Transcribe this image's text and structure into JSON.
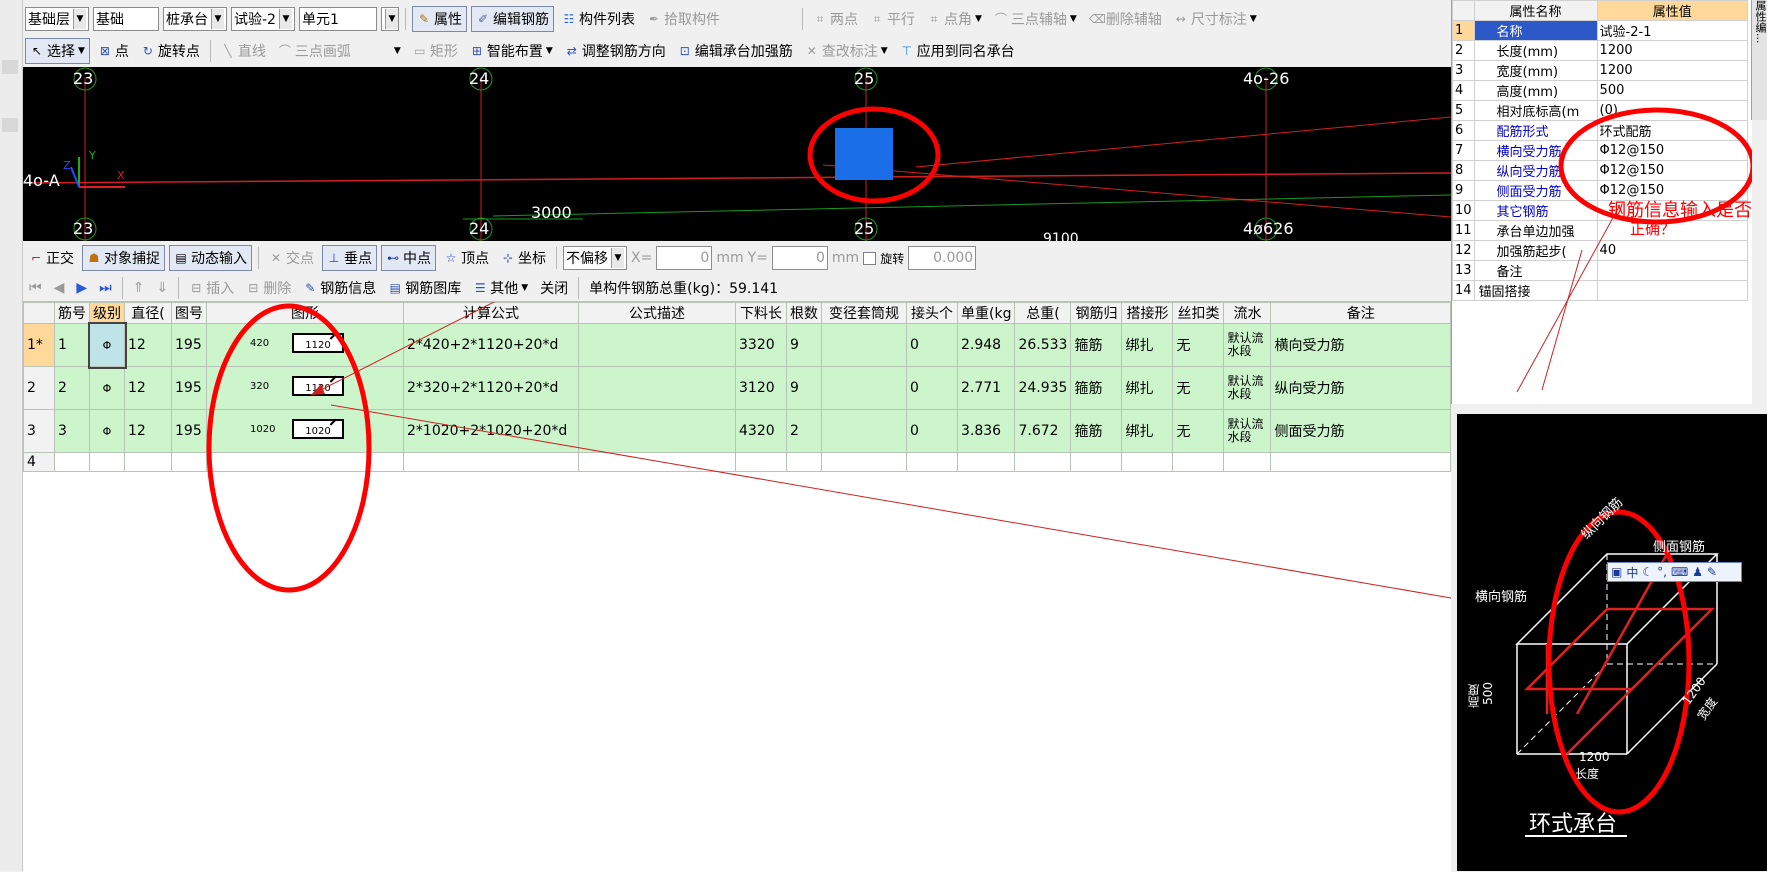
{
  "toolbar1": {
    "sel_category": "基础层",
    "sel_sub": "基础",
    "sel_type": "桩承台",
    "sel_name": "试验-2",
    "sel_unit": "单元1",
    "btn_attr": "属性",
    "btn_edit_rebar": "编辑钢筋",
    "btn_comp_list": "构件列表",
    "btn_pick": "拾取构件",
    "btn_two_pt": "两点",
    "btn_parallel": "平行",
    "btn_pt_angle": "点角",
    "btn_three_axis": "三点辅轴",
    "btn_del_axis": "删除辅轴",
    "btn_dim": "尺寸标注"
  },
  "toolbar2": {
    "btn_select": "选择",
    "btn_point": "点",
    "btn_rot_point": "旋转点",
    "btn_line": "直线",
    "btn_arc": "三点画弧",
    "btn_rect": "矩形",
    "btn_smart": "智能布置",
    "btn_adjust_dir": "调整钢筋方向",
    "btn_edit_reinf": "编辑承台加强筋",
    "btn_check_label": "查改标注",
    "btn_apply_same": "应用到同名承台"
  },
  "canvas": {
    "axis_labels_top": [
      "23",
      "24",
      "25",
      "4o-26"
    ],
    "axis_labels_bottom": [
      "23",
      "24",
      "25",
      "4ø626"
    ],
    "left_label": "4o-A",
    "dim_3000": "3000",
    "dim_bottom": "9100",
    "y_axis": "Y",
    "z_axis": "Z",
    "x_axis": "X"
  },
  "snapbar": {
    "ortho": "正交",
    "snap": "对象捕捉",
    "dyn_input": "动态输入",
    "intersect": "交点",
    "perp": "垂点",
    "mid": "中点",
    "vertex": "顶点",
    "coord": "坐标",
    "offset": "不偏移",
    "x_label": "X=",
    "x_val": "0",
    "mm1": "mm",
    "y_label": "Y=",
    "y_val": "0",
    "mm2": "mm",
    "rotate": "旋转",
    "rot_val": "0.000"
  },
  "rebar_toolbar": {
    "insert": "插入",
    "delete": "删除",
    "rebar_info": "钢筋信息",
    "rebar_lib": "钢筋图库",
    "other": "其他",
    "close": "关闭",
    "total": "单构件钢筋总重(kg)：59.141"
  },
  "grid": {
    "headers": [
      "筋号",
      "级别",
      "直径(",
      "图号",
      "图形",
      "计算公式",
      "公式描述",
      "下料长",
      "根数",
      "变径套筒规",
      "接头个",
      "单重(kg",
      "总重(",
      "钢筋归",
      "搭接形",
      "丝扣类",
      "流水",
      "备注"
    ],
    "rows": [
      {
        "rownum": "1*",
        "no": "1",
        "grade": "Φ",
        "dia": "12",
        "fig": "195",
        "left": "420",
        "mid": "1120",
        "formula": "2*420+2*1120+20*d",
        "desc": "",
        "len": "3320",
        "count": "9",
        "sleeve": "",
        "joints": "0",
        "unit_w": "2.948",
        "total_w": "26.533",
        "belong": "箍筋",
        "lap": "绑扎",
        "thread": "无",
        "flow": "默认流水段",
        "note": "横向受力筋"
      },
      {
        "rownum": "2",
        "no": "2",
        "grade": "Φ",
        "dia": "12",
        "fig": "195",
        "left": "320",
        "mid": "1120",
        "formula": "2*320+2*1120+20*d",
        "desc": "",
        "len": "3120",
        "count": "9",
        "sleeve": "",
        "joints": "0",
        "unit_w": "2.771",
        "total_w": "24.935",
        "belong": "箍筋",
        "lap": "绑扎",
        "thread": "无",
        "flow": "默认流水段",
        "note": "纵向受力筋"
      },
      {
        "rownum": "3",
        "no": "3",
        "grade": "Φ",
        "dia": "12",
        "fig": "195",
        "left": "1020",
        "mid": "1020",
        "formula": "2*1020+2*1020+20*d",
        "desc": "",
        "len": "4320",
        "count": "2",
        "sleeve": "",
        "joints": "0",
        "unit_w": "3.836",
        "total_w": "7.672",
        "belong": "箍筋",
        "lap": "绑扎",
        "thread": "无",
        "flow": "默认流水段",
        "note": "侧面受力筋"
      }
    ],
    "empty_rownum": "4"
  },
  "props": {
    "head_name": "属性名称",
    "head_val": "属性值",
    "rows": [
      {
        "n": "1",
        "k": "名称",
        "v": "试验-2-1",
        "blue": true
      },
      {
        "n": "2",
        "k": "长度(mm)",
        "v": "1200",
        "blue": false
      },
      {
        "n": "3",
        "k": "宽度(mm)",
        "v": "1200",
        "blue": false
      },
      {
        "n": "4",
        "k": "高度(mm)",
        "v": "500",
        "blue": false
      },
      {
        "n": "5",
        "k": "相对底标高(m",
        "v": "(0)",
        "blue": false
      },
      {
        "n": "6",
        "k": "配筋形式",
        "v": "环式配筋",
        "blue": true
      },
      {
        "n": "7",
        "k": "横向受力筋",
        "v": "Φ12@150",
        "blue": true
      },
      {
        "n": "8",
        "k": "纵向受力筋",
        "v": "Φ12@150",
        "blue": true
      },
      {
        "n": "9",
        "k": "侧面受力筋",
        "v": "Φ12@150",
        "blue": true
      },
      {
        "n": "10",
        "k": "其它钢筋",
        "v": "",
        "blue": true
      },
      {
        "n": "11",
        "k": "承台单边加强",
        "v": "",
        "blue": false
      },
      {
        "n": "12",
        "k": "加强筋起步(",
        "v": "40",
        "blue": false
      },
      {
        "n": "13",
        "k": "备注",
        "v": "",
        "blue": false
      },
      {
        "n": "14",
        "k": "锚固搭接",
        "v": "",
        "blue": false
      }
    ],
    "side_tab": "属性编..."
  },
  "annotation": {
    "text1": "钢筋信息输入是否",
    "text2": "正确？"
  },
  "diagram": {
    "label_long": "纵向钢筋",
    "label_side": "侧面钢筋",
    "label_trans": "横向钢筋",
    "label_height": "高度",
    "val_height": "500",
    "val_width": "1200",
    "label_width": "宽度",
    "val_len": "1200",
    "label_len": "长度",
    "title": "环式承台",
    "ime_cn": "中"
  },
  "colors": {
    "grid_green": "#ccf5cc",
    "annot_red": "#ff0000",
    "canvas_bg": "#000000",
    "cap_blue": "#1a6fe8"
  }
}
